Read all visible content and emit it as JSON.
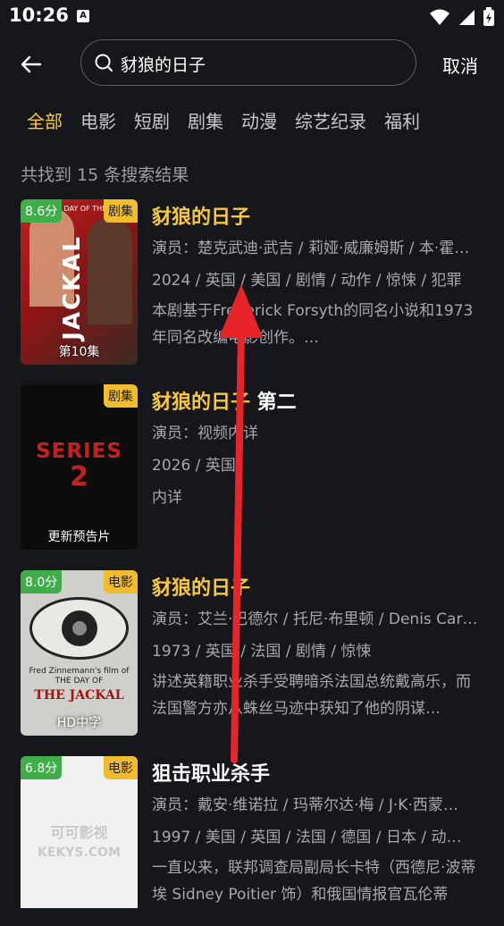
{
  "status_bar": {
    "time": "10:26",
    "sim_label": "A"
  },
  "search": {
    "query": "豺狼的日子",
    "cancel_label": "取消"
  },
  "tabs": [
    "全部",
    "电影",
    "短剧",
    "剧集",
    "动漫",
    "综艺纪录",
    "福利"
  ],
  "result_count": "共找到 15 条搜索结果",
  "results": [
    {
      "score": "8.6分",
      "type": "剧集",
      "episode": "第10集",
      "title": "豺狼的日子",
      "title_suffix": "",
      "cast": "演员：楚克武迪·武吉 / 莉娅·威廉姆斯 / 本·霍…",
      "meta": "2024 / 英国 / 美国 / 剧情 / 动作 / 惊悚 / 犯罪",
      "desc": "本剧基于Frederick Forsyth的同名小说和1973年同名改编电影创作。…",
      "poster_text": "JACKAL",
      "poster_top": "THE DAY OF THE"
    },
    {
      "score": "",
      "type": "剧集",
      "episode": "更新预告片",
      "title": "豺狼的日子",
      "title_suffix": " 第二",
      "cast": "演员：视频内详",
      "meta": "2026 / 英国",
      "desc": "内详",
      "poster_text": "SERIES",
      "poster_top": "2"
    },
    {
      "score": "8.0分",
      "type": "电影",
      "episode": "HD中字",
      "title": "豺狼的日子",
      "title_suffix": "",
      "cast": "演员：艾兰·巴德尔 / 托尼·布里顿 / Denis Car…",
      "meta": "1973 / 英国 / 法国 / 剧情 / 惊悚",
      "desc": "讲述英籍职业杀手受聘暗杀法国总统戴高乐，而法国警方亦从蛛丝马迹中获知了他的阴谋…",
      "poster_text": "THE JACKAL",
      "poster_top": "Fred Zinnemann's film of THE DAY OF"
    },
    {
      "score": "6.8分",
      "type": "电影",
      "episode": "",
      "title": "狙击职业杀手",
      "title_suffix": "",
      "cast": "演员：戴安·维诺拉 / 玛蒂尔达·梅 / J·K·西蒙…",
      "meta": "1997 / 美国 / 英国 / 法国 / 德国 / 日本 / 动…",
      "desc": "一直以来，联邦调查局副局长卡特（西德尼·波蒂埃 Sidney Poitier 饰）和俄国情报官瓦伦蒂",
      "poster_text": "KEKYS.COM",
      "poster_top": "可可影视"
    }
  ],
  "colors": {
    "accent": "#f7c935",
    "background": "#16171b",
    "score_badge": "#3fae48",
    "type_badge": "#f1bd2d",
    "arrow": "#e8242b"
  }
}
